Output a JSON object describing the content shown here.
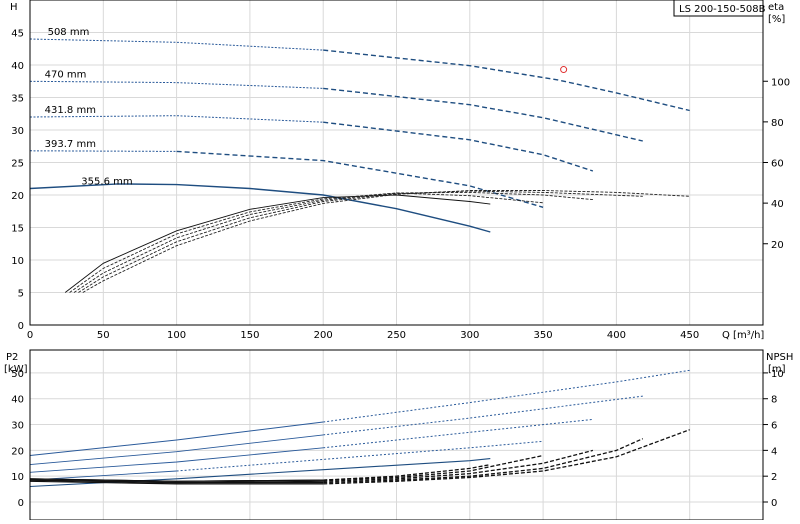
{
  "model_label": "LS 200-150-508B",
  "chart_data": [
    {
      "type": "line",
      "panel": "head-efficiency",
      "xlabel": "Q [m³/h]",
      "ylabel": "H",
      "ylabel_right_1": "eta",
      "ylabel_right_2": "[%]",
      "xlim": [
        0,
        500
      ],
      "ylim": [
        0,
        50
      ],
      "y2lim": [
        -20,
        140
      ],
      "x_ticks": [
        0,
        50,
        100,
        150,
        200,
        250,
        300,
        350,
        400,
        450
      ],
      "y_ticks": [
        0,
        5,
        10,
        15,
        20,
        25,
        30,
        35,
        40,
        45
      ],
      "y2_ticks": [
        20,
        40,
        60,
        80,
        100
      ],
      "grid": true,
      "head_curves": [
        {
          "name": "508 mm",
          "x": [
            0,
            100,
            200,
            300,
            360,
            400,
            450
          ],
          "y": [
            44.0,
            43.5,
            42.3,
            39.9,
            37.7,
            35.7,
            33.0
          ],
          "dash_from": 240
        },
        {
          "name": "470 mm",
          "x": [
            0,
            100,
            200,
            300,
            350,
            418
          ],
          "y": [
            37.5,
            37.3,
            36.4,
            33.9,
            31.9,
            28.3
          ],
          "dash_from": 220
        },
        {
          "name": "431.8 mm",
          "x": [
            0,
            100,
            200,
            300,
            350,
            384
          ],
          "y": [
            32.0,
            32.2,
            31.2,
            28.5,
            26.2,
            23.7
          ],
          "dash_from": 200
        },
        {
          "name": "393.7 mm",
          "x": [
            0,
            100,
            200,
            300,
            350
          ],
          "y": [
            26.8,
            26.7,
            25.3,
            21.4,
            18.1
          ],
          "dash_from": 180
        },
        {
          "name": "355.6 mm",
          "x": [
            0,
            60,
            100,
            150,
            200,
            250,
            300,
            314
          ],
          "y": [
            21.0,
            21.7,
            21.6,
            21.0,
            20.0,
            17.9,
            15.2,
            14.3
          ],
          "dash_from": 999
        }
      ],
      "efficiency_curves": [
        {
          "x": [
            24,
            50,
            100,
            150,
            200,
            250,
            300,
            314
          ],
          "y": [
            5.0,
            9.5,
            14.5,
            17.8,
            19.6,
            20.0,
            19.0,
            18.6
          ],
          "dash_from": 999
        },
        {
          "x": [
            27,
            50,
            100,
            150,
            200,
            250,
            300,
            350
          ],
          "y": [
            5.0,
            8.7,
            14.0,
            17.4,
            19.4,
            20.3,
            19.9,
            18.8
          ],
          "dash_from": 180
        },
        {
          "x": [
            30,
            50,
            100,
            150,
            200,
            250,
            300,
            350,
            384
          ],
          "y": [
            5.0,
            8.0,
            13.4,
            17.0,
            19.2,
            20.3,
            20.4,
            20.0,
            19.3
          ],
          "dash_from": 200
        },
        {
          "x": [
            33,
            50,
            100,
            150,
            200,
            250,
            300,
            350,
            418
          ],
          "y": [
            5.0,
            7.4,
            12.8,
            16.5,
            19.0,
            20.2,
            20.6,
            20.4,
            19.8
          ],
          "dash_from": 220
        },
        {
          "x": [
            36,
            50,
            100,
            150,
            200,
            250,
            300,
            350,
            400,
            450
          ],
          "y": [
            5.0,
            6.8,
            12.2,
            16.0,
            18.7,
            20.1,
            20.7,
            20.7,
            20.4,
            19.8
          ],
          "dash_from": 240
        }
      ],
      "duty_point": {
        "x": 364,
        "y": 39.3
      }
    },
    {
      "type": "line",
      "panel": "power-npsh",
      "ylabel_1": "P2",
      "ylabel_2": "[kW]",
      "ylabel_right_1": "NPSH",
      "ylabel_right_2": "[m]",
      "xlim": [
        0,
        500
      ],
      "ylim": [
        0,
        55
      ],
      "y2lim": [
        0,
        11
      ],
      "y_ticks": [
        0,
        10,
        20,
        30,
        40,
        50
      ],
      "y2_ticks": [
        0,
        2,
        4,
        6,
        8,
        10
      ],
      "grid": true,
      "power_curves": [
        {
          "x": [
            0,
            100,
            200,
            300,
            400,
            450
          ],
          "y": [
            18.0,
            24.0,
            31.0,
            38.5,
            46.5,
            51.0
          ],
          "dash_from": 240
        },
        {
          "x": [
            0,
            100,
            200,
            300,
            418
          ],
          "y": [
            14.5,
            19.5,
            26.0,
            32.5,
            41.0
          ],
          "dash_from": 220
        },
        {
          "x": [
            0,
            100,
            200,
            300,
            384
          ],
          "y": [
            11.5,
            15.5,
            21.0,
            27.0,
            32.0
          ],
          "dash_from": 200
        },
        {
          "x": [
            0,
            100,
            200,
            300,
            350
          ],
          "y": [
            8.5,
            12.0,
            16.5,
            21.0,
            23.5
          ],
          "dash_from": 180
        },
        {
          "x": [
            0,
            100,
            200,
            300,
            314
          ],
          "y": [
            6.0,
            9.0,
            12.5,
            16.0,
            16.8
          ],
          "dash_from": 999
        }
      ],
      "npsh_curves": [
        {
          "x": [
            0,
            100,
            200,
            250,
            300,
            314
          ],
          "y": [
            1.8,
            1.6,
            1.7,
            2.0,
            2.6,
            2.9
          ]
        },
        {
          "x": [
            0,
            100,
            200,
            250,
            300,
            350
          ],
          "y": [
            1.8,
            1.6,
            1.7,
            1.9,
            2.4,
            3.6
          ]
        },
        {
          "x": [
            0,
            100,
            200,
            250,
            300,
            350,
            384
          ],
          "y": [
            1.7,
            1.5,
            1.6,
            1.8,
            2.2,
            3.0,
            4.0
          ]
        },
        {
          "x": [
            0,
            100,
            200,
            250,
            300,
            350,
            400,
            418
          ],
          "y": [
            1.7,
            1.5,
            1.5,
            1.7,
            2.0,
            2.6,
            4.0,
            4.9
          ]
        },
        {
          "x": [
            0,
            100,
            200,
            250,
            300,
            350,
            400,
            450
          ],
          "y": [
            1.6,
            1.4,
            1.4,
            1.6,
            1.9,
            2.4,
            3.5,
            5.6
          ]
        }
      ]
    }
  ]
}
